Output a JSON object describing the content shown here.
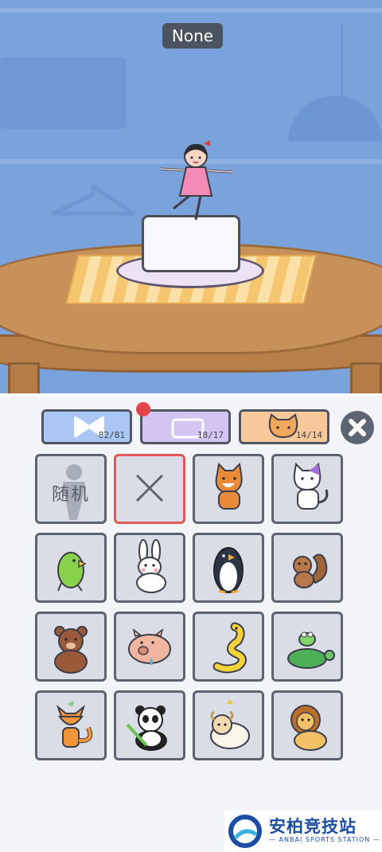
{
  "scene": {
    "title": "None"
  },
  "tabs": [
    {
      "name": "bow",
      "count": "82/81",
      "color": "#a9c7f2"
    },
    {
      "name": "hat",
      "count": "18/17",
      "color": "#d3c4f1"
    },
    {
      "name": "pet",
      "count": "14/14",
      "color": "#f8c89a"
    }
  ],
  "grid": {
    "random_label": "随机",
    "items": [
      "random",
      "none",
      "shiba",
      "cat",
      "parrot",
      "rabbit",
      "penguin",
      "squirrel",
      "bear",
      "pig",
      "snake",
      "turtle-frog",
      "fox",
      "panda",
      "sheep",
      "lion"
    ]
  },
  "colors": {
    "sky": "#7aa3dc",
    "panel": "#f3f4f7",
    "selected_border": "#e25757",
    "badge": "#e3434b"
  },
  "watermark": {
    "title": "安柏竞技站",
    "subtitle": "— ANBAI SPORTS STATION —"
  }
}
